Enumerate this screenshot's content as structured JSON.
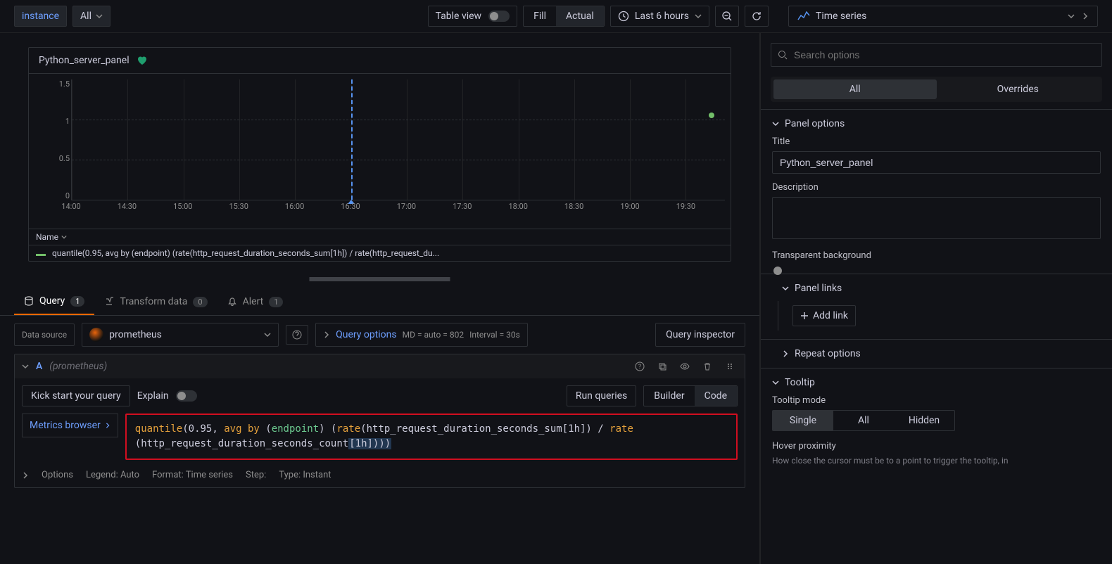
{
  "toolbar": {
    "instance_label": "instance",
    "all_label": "All",
    "table_view_label": "Table view",
    "fill_label": "Fill",
    "actual_label": "Actual",
    "time_range": "Last 6 hours",
    "viz_type": "Time series"
  },
  "panel": {
    "title": "Python_server_panel",
    "legend_header": "Name",
    "legend_text": "quantile(0.95, avg by (endpoint) (rate(http_request_duration_seconds_sum[1h]) / rate(http_request_du..."
  },
  "chart_data": {
    "type": "line",
    "title": "Python_server_panel",
    "xlabel": "",
    "ylabel": "",
    "ylim": [
      0,
      1.5
    ],
    "y_ticks": [
      0,
      0.5,
      1,
      1.5
    ],
    "x_ticks": [
      "14:00",
      "14:30",
      "15:00",
      "15:30",
      "16:00",
      "16:30",
      "17:00",
      "17:30",
      "18:00",
      "18:30",
      "19:00",
      "19:30"
    ],
    "cursor_x": "16:30",
    "series": [
      {
        "name": "quantile(0.95, avg by (endpoint) (rate(http_request_duration_seconds_sum[1h]) / rate(http_request_du...",
        "color": "#73bf69",
        "points": [
          {
            "x": "19:45",
            "y": 1.05
          }
        ]
      }
    ]
  },
  "tabs": {
    "query": {
      "label": "Query",
      "badge": "1"
    },
    "transform": {
      "label": "Transform data",
      "badge": "0"
    },
    "alert": {
      "label": "Alert",
      "badge": "1"
    }
  },
  "query_bar": {
    "data_source_label": "Data source",
    "data_source_value": "prometheus",
    "query_options_label": "Query options",
    "md_text": "MD = auto = 802",
    "interval_text": "Interval = 30s",
    "inspector_label": "Query inspector"
  },
  "query_row": {
    "letter": "A",
    "subtitle": "(prometheus)",
    "kick_start": "Kick start your query",
    "explain": "Explain",
    "run": "Run queries",
    "builder": "Builder",
    "code": "Code",
    "metrics_browser": "Metrics browser",
    "code_html": "<span class='kw'>quantile</span>(0.95, <span class='kw'>avg</span> <span class='kw'>by</span> (<span class='id'>endpoint</span>) (<span class='fn'>rate</span>(http_request_duration_seconds_sum[1h]) / <span class='fn'>rate</span><br>(http_request_duration_seconds_count<span class='hl'>[1h])))</span>",
    "footer": {
      "options": "Options",
      "legend": "Legend: Auto",
      "format": "Format: Time series",
      "step": "Step:",
      "type": "Type: Instant"
    }
  },
  "sidebar": {
    "search_placeholder": "Search options",
    "tab_all": "All",
    "tab_overrides": "Overrides",
    "panel_options": {
      "header": "Panel options",
      "title_label": "Title",
      "title_value": "Python_server_panel",
      "description_label": "Description",
      "transparent_label": "Transparent background"
    },
    "panel_links": {
      "header": "Panel links",
      "add_link": "Add link"
    },
    "repeat": {
      "header": "Repeat options"
    },
    "tooltip": {
      "header": "Tooltip",
      "mode_label": "Tooltip mode",
      "single": "Single",
      "all": "All",
      "hidden": "Hidden",
      "hover_label": "Hover proximity",
      "hover_help": "How close the cursor must be to a point to trigger the tooltip, in"
    }
  }
}
